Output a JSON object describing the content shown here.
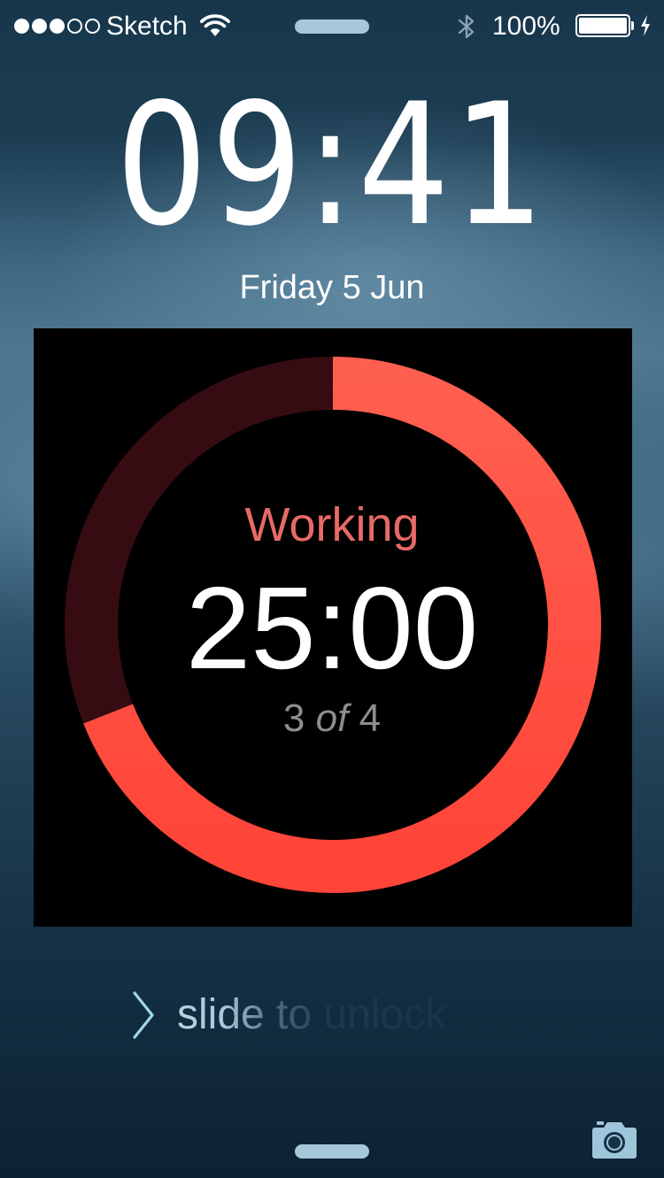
{
  "status_bar": {
    "signal_bars_filled": 3,
    "signal_bars_total": 5,
    "carrier": "Sketch",
    "wifi_icon": "wifi-icon",
    "bluetooth_icon": "bluetooth-icon",
    "battery_percent": "100%",
    "battery_level": 1.0,
    "charging_icon": "bolt-icon"
  },
  "lock_screen": {
    "time": "09:41",
    "date": "Friday 5 Jun"
  },
  "timer_widget": {
    "state": "Working",
    "countdown": "25:00",
    "session_current": "3",
    "session_of": "of",
    "session_total": "4",
    "progress_fraction": 0.69,
    "colors": {
      "progress": "#ff5a4e",
      "track": "#360c12",
      "state_text": "#e86a66",
      "session_text": "#8d8d8d"
    }
  },
  "unlock": {
    "label": "slide to unlock",
    "chevron_icon": "chevron-right-icon"
  },
  "camera_icon": "camera-icon"
}
